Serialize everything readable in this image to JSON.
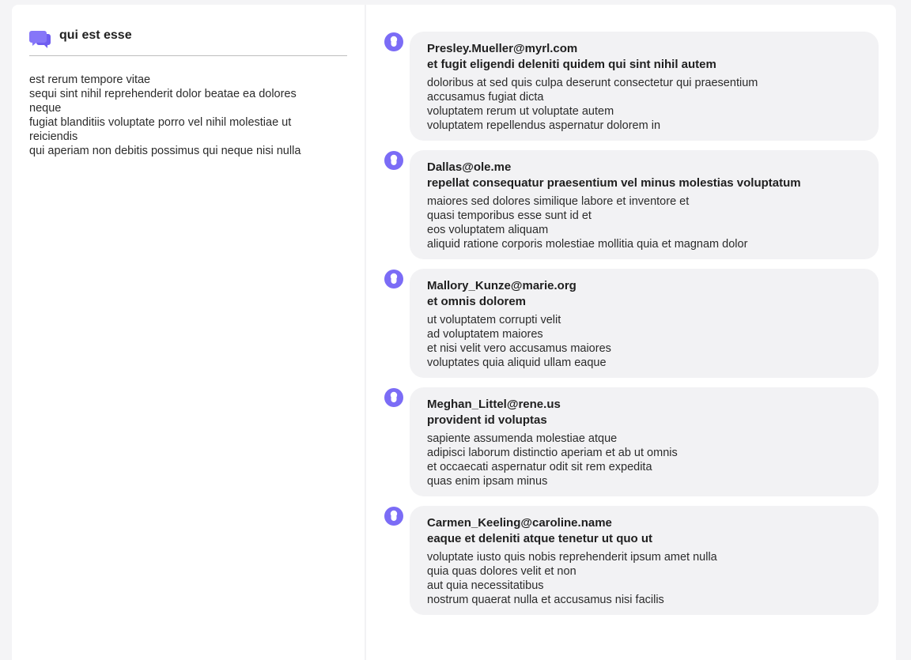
{
  "post": {
    "title": "qui est esse",
    "icon": "chat-bubbles-icon",
    "accent_color": "#7b6cf6",
    "body_lines": [
      "est rerum tempore vitae",
      "sequi sint nihil reprehenderit dolor beatae ea dolores neque",
      "fugiat blanditiis voluptate porro vel nihil molestiae ut reiciendis",
      "qui aperiam non debitis possimus qui neque nisi nulla"
    ]
  },
  "comments": [
    {
      "email": "Presley.Mueller@myrl.com",
      "name": "et fugit eligendi deleniti quidem qui sint nihil autem",
      "body_lines": [
        "doloribus at sed quis culpa deserunt consectetur qui praesentium",
        "accusamus fugiat dicta",
        "voluptatem rerum ut voluptate autem",
        "voluptatem repellendus aspernatur dolorem in"
      ]
    },
    {
      "email": "Dallas@ole.me",
      "name": "repellat consequatur praesentium vel minus molestias voluptatum",
      "body_lines": [
        "maiores sed dolores similique labore et inventore et",
        "quasi temporibus esse sunt id et",
        "eos voluptatem aliquam",
        "aliquid ratione corporis molestiae mollitia quia et magnam dolor"
      ]
    },
    {
      "email": "Mallory_Kunze@marie.org",
      "name": "et omnis dolorem",
      "body_lines": [
        "ut voluptatem corrupti velit",
        "ad voluptatem maiores",
        "et nisi velit vero accusamus maiores",
        "voluptates quia aliquid ullam eaque"
      ]
    },
    {
      "email": "Meghan_Littel@rene.us",
      "name": "provident id voluptas",
      "body_lines": [
        "sapiente assumenda molestiae atque",
        "adipisci laborum distinctio aperiam et ab ut omnis",
        "et occaecati aspernatur odit sit rem expedita",
        "quas enim ipsam minus"
      ]
    },
    {
      "email": "Carmen_Keeling@caroline.name",
      "name": "eaque et deleniti atque tenetur ut quo ut",
      "body_lines": [
        "voluptate iusto quis nobis reprehenderit ipsum amet nulla",
        "quia quas dolores velit et non",
        "aut quia necessitatibus",
        "nostrum quaerat nulla et accusamus nisi facilis"
      ]
    }
  ],
  "comment_avatar_icon": "user-icon"
}
